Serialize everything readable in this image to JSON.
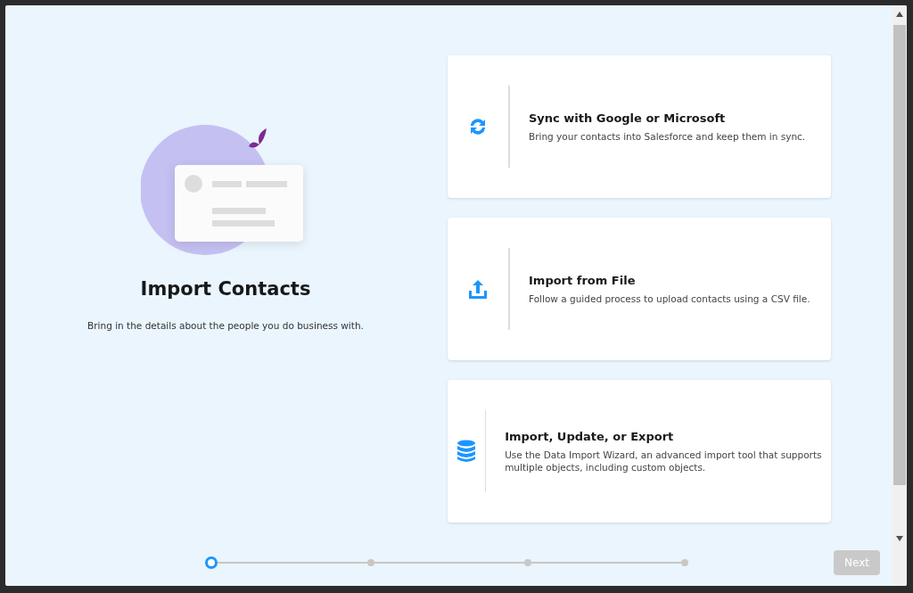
{
  "intro": {
    "title": "Import Contacts",
    "description": "Bring in the details about the people you do business with."
  },
  "options": [
    {
      "kind": "sync",
      "title": "Sync with Google or Microsoft",
      "description": "Bring your contacts into Salesforce and keep them in sync."
    },
    {
      "kind": "upload",
      "title": "Import from File",
      "description": "Follow a guided process to upload contacts using a CSV file."
    },
    {
      "kind": "database",
      "title": "Import, Update, or Export",
      "description": "Use the Data Import Wizard, an advanced import tool that supports multiple objects, including custom objects."
    }
  ],
  "steps": [
    {
      "selected": true
    },
    {
      "selected": false
    },
    {
      "selected": false
    },
    {
      "selected": false
    }
  ],
  "next_button": {
    "label": "Next",
    "disabled": true
  }
}
